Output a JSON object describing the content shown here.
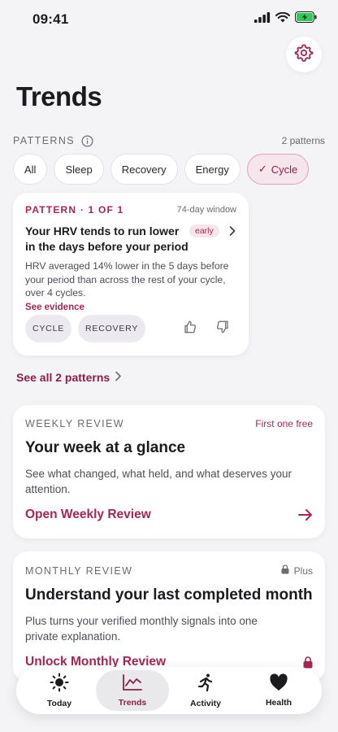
{
  "status_bar": {
    "time": "09:41"
  },
  "page": {
    "title": "Trends"
  },
  "patterns": {
    "section_label": "PATTERNS",
    "count_text": "2 patterns",
    "chips": [
      {
        "label": "All",
        "active": false
      },
      {
        "label": "Sleep",
        "active": false
      },
      {
        "label": "Recovery",
        "active": false
      },
      {
        "label": "Energy",
        "active": false
      },
      {
        "label": "Cycle",
        "active": true,
        "check": "✓"
      }
    ],
    "card": {
      "label": "PATTERN · 1 OF 1",
      "window": "74-day window",
      "title": "Your HRV tends to run lower in the days before your period",
      "badge": "early",
      "body": "HRV averaged 14% lower in the 5 days before your period than across the rest of your cycle, over 4 cycles.",
      "evidence_link": "See evidence",
      "tags": [
        "CYCLE",
        "RECOVERY"
      ]
    },
    "see_all": "See all 2 patterns"
  },
  "weekly_review": {
    "label": "WEEKLY REVIEW",
    "right_text": "First one free",
    "title": "Your week at a glance",
    "body": "See what changed, what held, and what deserves your attention.",
    "action": "Open Weekly Review"
  },
  "monthly_review": {
    "label": "MONTHLY REVIEW",
    "right_text": "Plus",
    "title": "Understand your last completed month",
    "body": "Plus turns your verified monthly signals into one private explanation.",
    "action": "Unlock Monthly Review"
  },
  "tab_bar": {
    "tabs": [
      {
        "label": "Today",
        "icon": "sun-icon",
        "active": false
      },
      {
        "label": "Trends",
        "icon": "chart-icon",
        "active": true
      },
      {
        "label": "Activity",
        "icon": "runner-icon",
        "active": false
      },
      {
        "label": "Health",
        "icon": "heart-icon",
        "active": false
      }
    ]
  },
  "colors": {
    "accent": "#a52656",
    "background": "#f4f3f6",
    "card": "#ffffff"
  }
}
